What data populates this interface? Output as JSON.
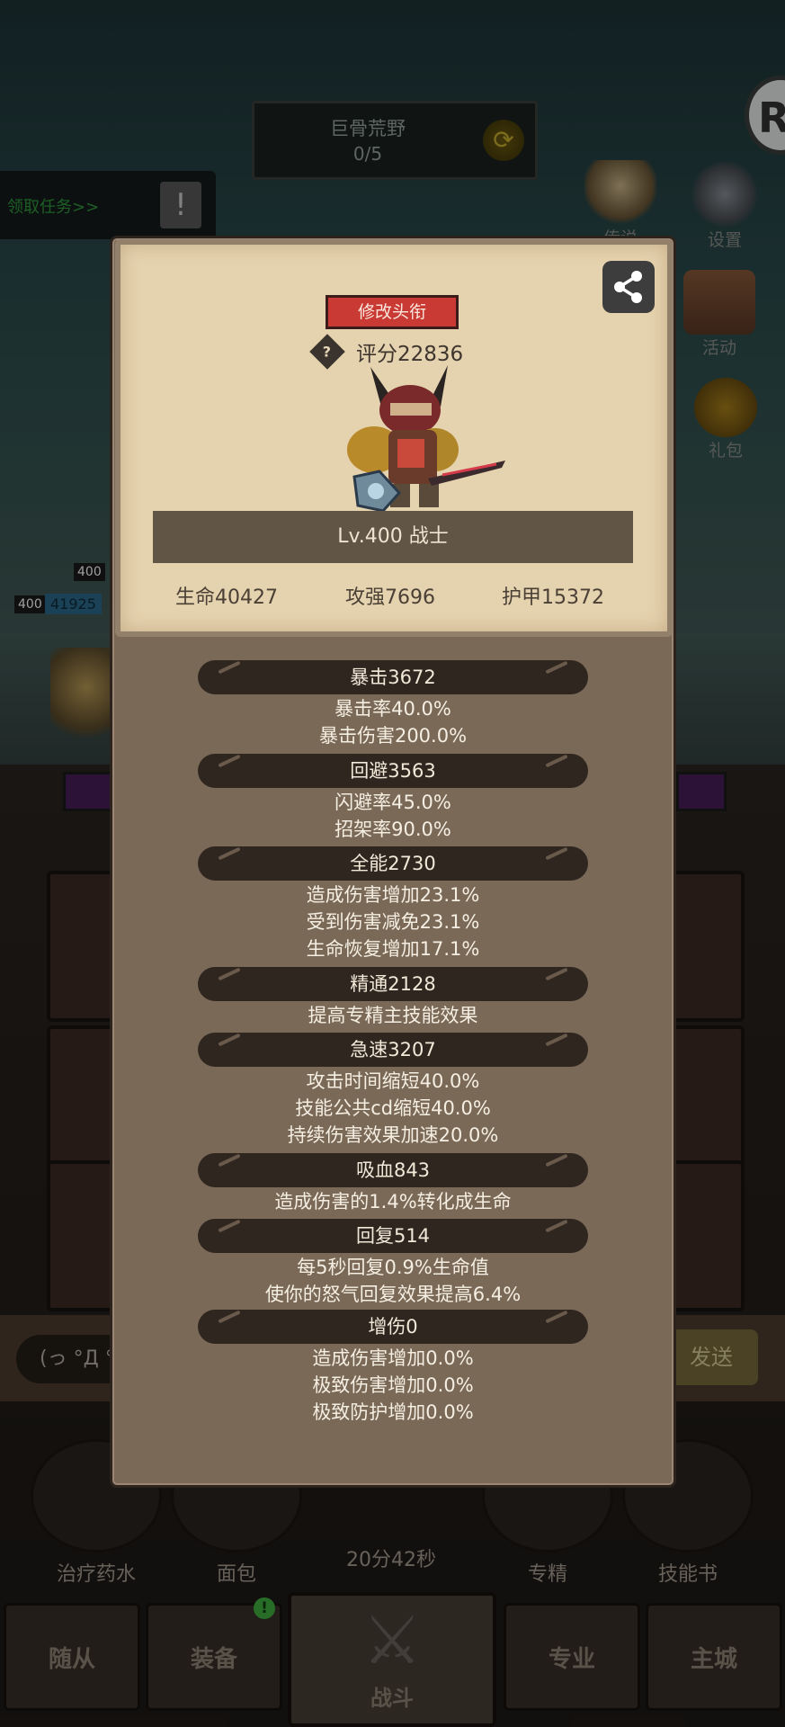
{
  "background": {
    "stage": {
      "name": "巨骨荒野",
      "count": "0/5"
    },
    "task_label": "领取任务>>",
    "side_icons": [
      {
        "label": "传说",
        "icon": "eagle-icon"
      },
      {
        "label": "设置",
        "icon": "gear-icon"
      },
      {
        "label": "活动",
        "icon": "scroll-icon"
      },
      {
        "label": "礼包",
        "icon": "gift-icon"
      }
    ],
    "hp_tags": [
      "400",
      "400",
      "41925"
    ],
    "chat_input_text": "(っ °Д °",
    "send_label": "发送",
    "quick_items": [
      "治疗药水",
      "面包",
      "专精",
      "技能书"
    ],
    "timer": "20分42秒",
    "nav": {
      "followers": "随从",
      "equipment": "装备",
      "battle": "战斗",
      "profession": "专业",
      "city": "主城",
      "badge": "!"
    }
  },
  "profile": {
    "title_button": "修改头衔",
    "score_help": "?",
    "score": "评分22836",
    "level_class": "Lv.400 战士",
    "hp": "生命40427",
    "attack": "攻强7696",
    "armor": "护甲15372"
  },
  "stats": [
    {
      "header": "暴击3672",
      "lines": [
        "暴击率40.0%",
        "暴击伤害200.0%"
      ]
    },
    {
      "header": "回避3563",
      "lines": [
        "闪避率45.0%",
        "招架率90.0%"
      ]
    },
    {
      "header": "全能2730",
      "lines": [
        "造成伤害增加23.1%",
        "受到伤害减免23.1%",
        "生命恢复增加17.1%"
      ]
    },
    {
      "header": "精通2128",
      "lines": [
        "提高专精主技能效果"
      ]
    },
    {
      "header": "急速3207",
      "lines": [
        "攻击时间缩短40.0%",
        "技能公共cd缩短40.0%",
        "持续伤害效果加速20.0%"
      ]
    },
    {
      "header": "吸血843",
      "lines": [
        "造成伤害的1.4%转化成生命"
      ]
    },
    {
      "header": "回复514",
      "lines": [
        "每5秒回复0.9%生命值",
        "使你的怒气回复效果提高6.4%"
      ]
    },
    {
      "header": "增伤0",
      "lines": [
        "造成伤害增加0.0%",
        "极致伤害增加0.0%",
        "极致防护增加0.0%"
      ]
    }
  ],
  "colors": {
    "accent_red": "#c83a33",
    "panel": "#7a6957",
    "card": "#e5d2ae",
    "stat_header": "#302620"
  }
}
